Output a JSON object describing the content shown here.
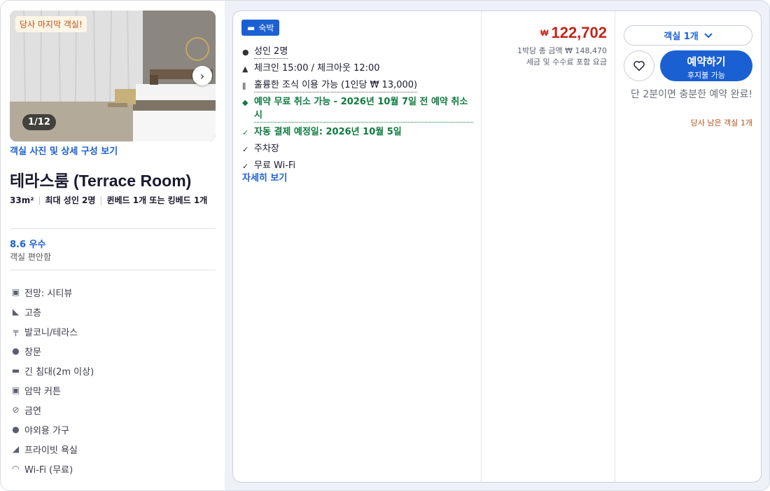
{
  "photo": {
    "badge": "당사 마지막 객실!",
    "counter": "1/12",
    "link": "객실 사진 및 상세 구성 보기"
  },
  "room": {
    "title": "테라스룸 (Terrace Room)",
    "size": "33m²",
    "occupancy": "최대 성인 2명",
    "beds": "퀸베드 1개 또는 킹베드 1개",
    "rating": "8.6 우수",
    "rating_sub": "객실 편안함"
  },
  "amenities": [
    {
      "icon": "view-icon",
      "label": "전망: 시티뷰"
    },
    {
      "icon": "floor-icon",
      "label": "고층"
    },
    {
      "icon": "balcony-icon",
      "label": "발코니/테라스"
    },
    {
      "icon": "check-badge-icon",
      "label": "창문"
    },
    {
      "icon": "bed-icon",
      "label": "긴 침대(2m 이상)"
    },
    {
      "icon": "curtain-icon",
      "label": "암막 커튼"
    },
    {
      "icon": "no-smoking-icon",
      "label": "금연"
    },
    {
      "icon": "check-badge-icon",
      "label": "야외용 가구"
    },
    {
      "icon": "bath-icon",
      "label": "프라이빗 욕실"
    },
    {
      "icon": "wifi-icon",
      "label": "Wi-Fi (무료)"
    }
  ],
  "offer": {
    "tag": "숙박",
    "features": [
      {
        "icon": "person-icon",
        "text": "성인 2명",
        "style": "underline"
      },
      {
        "icon": "bell-icon",
        "text": "체크인 15:00 / 체크아웃 12:00",
        "style": "plain"
      },
      {
        "icon": "utensils-icon",
        "text": "훌륭한 조식 이용 가능 (1인당 ₩ 13,000)",
        "style": "underline"
      },
      {
        "icon": "shield-check-icon",
        "text": "예약 무료 취소 가능 - 2026년 10월 7일 전 예약 취소 시",
        "style": "green-underline"
      },
      {
        "icon": "check-icon",
        "text": "자동 결제 예정일: 2026년 10월 5일",
        "style": "green"
      },
      {
        "icon": "check-icon",
        "text": "주차장",
        "style": "plain"
      },
      {
        "icon": "check-icon",
        "text": "무료 Wi-Fi",
        "style": "plain"
      }
    ],
    "more_link": "자세히 보기"
  },
  "price": {
    "currency": "₩",
    "amount": "122,702",
    "total_line": "1박당 총 금액 ₩ 148,470",
    "tax_line": "세금 및 수수료 포함 요금"
  },
  "booking": {
    "room_select": "객실 1개",
    "reserve_label": "예약하기",
    "reserve_sub": "후지불 가능",
    "urgency": "단 2분이면 충분한 예약 완료!",
    "remaining": "당사 남은 객실 1개"
  },
  "colors": {
    "accent": "#1b60d3",
    "price": "#c0261b",
    "success": "#0d7a3f",
    "warning": "#b4541a"
  }
}
